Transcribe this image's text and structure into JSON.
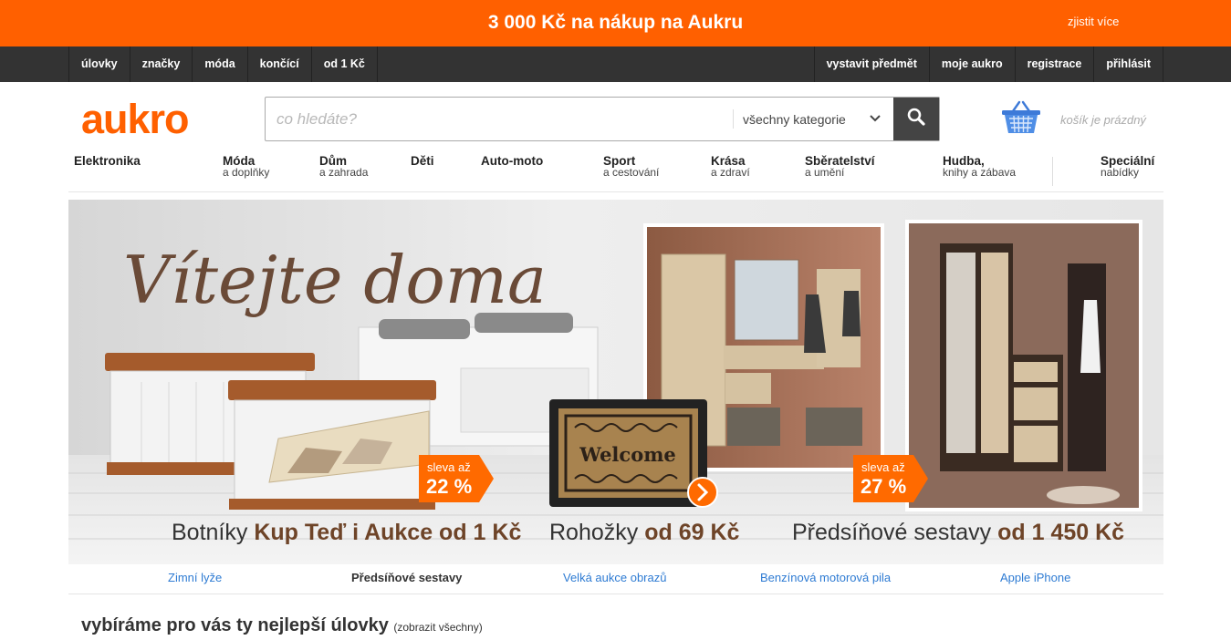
{
  "promo": {
    "text": "3 000 Kč na nákup na Aukru",
    "link": "zjistit více"
  },
  "topnav": {
    "left": [
      "úlovky",
      "značky",
      "móda",
      "končící",
      "od 1 Kč"
    ],
    "right": [
      "vystavit předmět",
      "moje aukro",
      "registrace",
      "přihlásit"
    ]
  },
  "header": {
    "logo": "aukro",
    "search_placeholder": "co hledáte?",
    "category_select": "všechny kategorie",
    "cart_text": "košík je prázdný"
  },
  "categories": [
    {
      "name": "Elektronika",
      "sub": ""
    },
    {
      "name": "Móda",
      "sub": "a doplňky"
    },
    {
      "name": "Dům",
      "sub": "a zahrada"
    },
    {
      "name": "Děti",
      "sub": ""
    },
    {
      "name": "Auto-moto",
      "sub": ""
    },
    {
      "name": "Sport",
      "sub": "a cestování"
    },
    {
      "name": "Krása",
      "sub": "a zdraví"
    },
    {
      "name": "Sběratelství",
      "sub": "a umění"
    },
    {
      "name": "Hudba,",
      "sub": "knihy a zábava"
    },
    {
      "name": "Speciální",
      "sub": "nabídky"
    }
  ],
  "banner": {
    "headline": "Vítejte doma",
    "badge1": {
      "top": "sleva až",
      "value": "22 %"
    },
    "badge2": {
      "top": "sleva až",
      "value": "27 %"
    },
    "mat_text": "Welcome",
    "captions": [
      {
        "plain": "Botníky",
        "bold": "Kup Teď i Aukce od 1 Kč"
      },
      {
        "plain": "Rohožky",
        "bold": "od 69 Kč"
      },
      {
        "plain": "Předsíňové sestavy",
        "bold": "od 1 450 Kč"
      }
    ]
  },
  "carousel_tabs": [
    "Zimní lyže",
    "Předsíňové sestavy",
    "Velká aukce obrazů",
    "Benzínová motorová pila",
    "Apple iPhone"
  ],
  "carousel_active_index": 1,
  "section": {
    "title": "vybíráme pro vás ty nejlepší úlovky",
    "more": "(zobrazit všechny)"
  },
  "colors": {
    "brand": "#ff6000",
    "nav": "#333333",
    "link": "#2e7bd3",
    "caption_bold": "#6e4428"
  }
}
